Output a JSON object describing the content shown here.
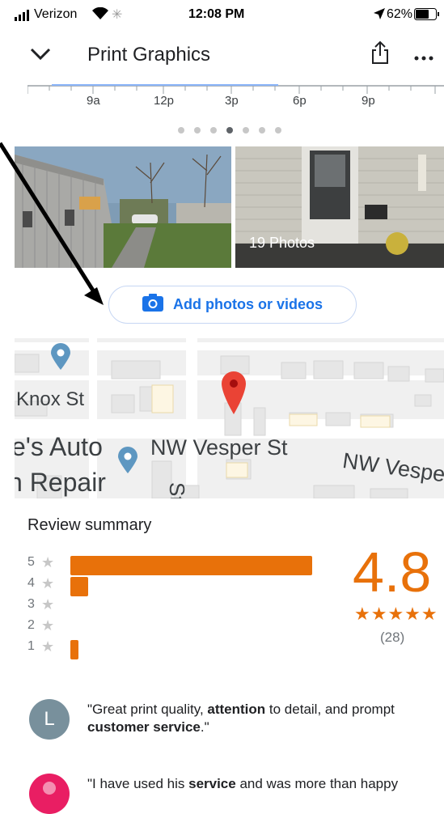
{
  "status": {
    "carrier": "Verizon",
    "time": "12:08 PM",
    "battery": "62%"
  },
  "header": {
    "title": "Print Graphics"
  },
  "timeline": {
    "ticks": [
      "9a",
      "12p",
      "3p",
      "6p",
      "9p"
    ],
    "pages": 7,
    "active_page": 3
  },
  "photos": {
    "count_label": "19 Photos"
  },
  "add_button": {
    "label": "Add photos or videos"
  },
  "map": {
    "labels": {
      "knox": "Knox St",
      "auto1": "e's Auto",
      "repair": "n Repair",
      "vesper1": "NW Vesper St",
      "vesper2": "NW Vespe",
      "st": "St"
    }
  },
  "reviews": {
    "title": "Review summary",
    "rows": [
      {
        "label": "5",
        "fraction": 0.95
      },
      {
        "label": "4",
        "fraction": 0.07
      },
      {
        "label": "3",
        "fraction": 0
      },
      {
        "label": "2",
        "fraction": 0
      },
      {
        "label": "1",
        "fraction": 0.03
      }
    ],
    "rating": "4.8",
    "stars": "★★★★★",
    "count": "(28)",
    "list": [
      {
        "avatar_letter": "L",
        "avatar_color": "#78909c",
        "parts": [
          "\"Great print quality, ",
          "attention",
          " to detail, and prompt ",
          "customer service",
          ".\""
        ]
      },
      {
        "avatar_color": "#e91e63",
        "parts": [
          "\"I have used his ",
          "service",
          " and was more than happy"
        ]
      }
    ]
  },
  "colors": {
    "accent": "#e8710a",
    "link": "#1a73e8",
    "pin": "#ea4335"
  }
}
